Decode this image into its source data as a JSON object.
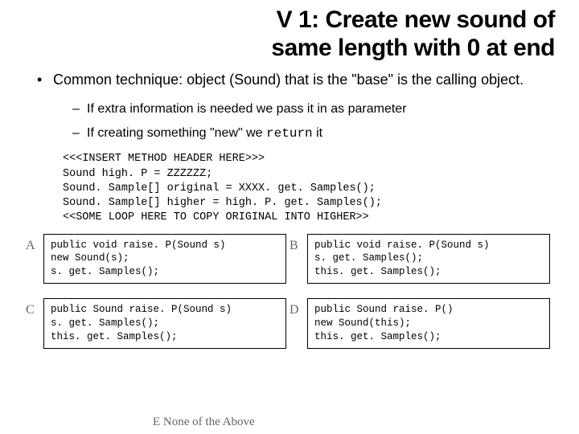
{
  "title_line1": "V 1: Create new sound of",
  "title_line2": "same length with 0 at end",
  "bullet_main": "Common technique: object (Sound) that is the \"base\" is the calling object.",
  "sub1": "If extra information is needed we pass it in as parameter",
  "sub2_prefix": "If creating something \"new\" we ",
  "sub2_code": "return",
  "sub2_suffix": " it",
  "code": "<<<INSERT METHOD HEADER HERE>>>\nSound high. P = ZZZZZZ;\nSound. Sample[] original = XXXX. get. Samples();\nSound. Sample[] higher = high. P. get. Samples();\n<<SOME LOOP HERE TO COPY ORIGINAL INTO HIGHER>>",
  "options": {
    "a": {
      "label": "A",
      "code": "public void raise. P(Sound s)\nnew Sound(s);\ns. get. Samples();"
    },
    "b": {
      "label": "B",
      "code": "public void raise. P(Sound s)\ns. get. Samples();\nthis. get. Samples();"
    },
    "c": {
      "label": "C",
      "code": "public Sound raise. P(Sound s)\ns. get. Samples();\nthis. get. Samples();"
    },
    "d": {
      "label": "D",
      "code": "public Sound raise. P()\nnew Sound(this);\nthis. get. Samples();"
    }
  },
  "footnote": "E  None of the Above"
}
